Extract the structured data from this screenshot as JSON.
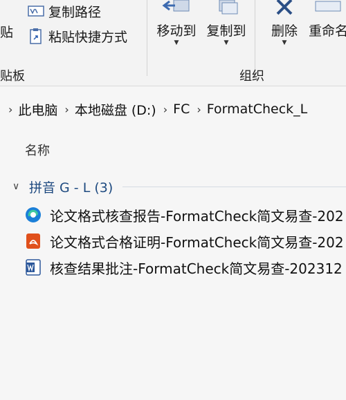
{
  "ribbon": {
    "paste_label": "贴",
    "copy_path_label": "复制路径",
    "paste_shortcut_label": "粘贴快捷方式",
    "clipboard_group_label": "贴板",
    "move_to_label": "移动到",
    "copy_to_label": "复制到",
    "organize_group_label": "组织",
    "delete_label": "删除",
    "rename_label": "重命名"
  },
  "address": {
    "crumbs": [
      "此电脑",
      "本地磁盘 (D:)",
      "FC",
      "FormatCheck_L"
    ]
  },
  "list": {
    "column_name": "名称",
    "group_title": "拼音 G - L (3)",
    "files": [
      {
        "name": "论文格式核查报告-FormatCheck简文易查-202",
        "icon": "edge-html-icon"
      },
      {
        "name": "论文格式合格证明-FormatCheck简文易查-202",
        "icon": "pdf-icon"
      },
      {
        "name": "核查结果批注-FormatCheck简文易查-202312",
        "icon": "word-doc-icon"
      }
    ]
  },
  "colors": {
    "accent": "#1e4a80",
    "edge_blue": "#1b7fd8",
    "pdf_orange": "#e0501b",
    "word_blue": "#2b579a"
  }
}
